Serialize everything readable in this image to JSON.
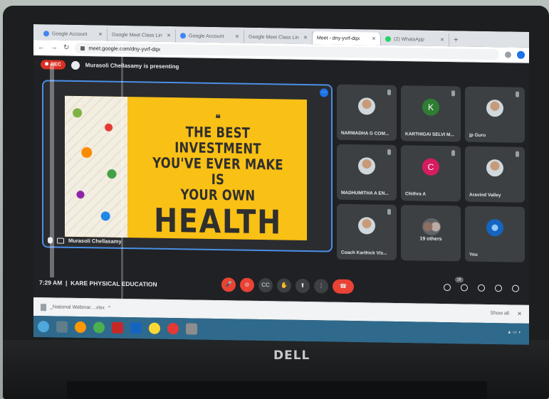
{
  "browser": {
    "tabs": [
      {
        "label": "Google Account",
        "active": false
      },
      {
        "label": "Google Meet Class Lin",
        "active": false
      },
      {
        "label": "Google Account",
        "active": false
      },
      {
        "label": "Google Meet Class Lin",
        "active": false
      },
      {
        "label": "Meet - dny-yvrf-dqx",
        "active": true
      },
      {
        "label": "(2) WhatsApp",
        "active": false
      }
    ],
    "url": "meet.google.com/dny-yvrf-dqx"
  },
  "meet": {
    "rec_label": "REC",
    "presenting_text": "Murasoli Chellasamy is presenting",
    "slide": {
      "line1": "THE BEST INVESTMENT",
      "line2": "YOU'VE EVER MAKE IS",
      "line3": "YOUR OWN",
      "line4": "HEALTH"
    },
    "presenter_name": "Murasoli Chellasamy",
    "participants": [
      {
        "name": "NARMADHA G COM...",
        "avatar": "photo"
      },
      {
        "name": "KARTHIGAI SELVI M...",
        "avatar": "K"
      },
      {
        "name": "jp Guru",
        "avatar": "photo"
      },
      {
        "name": "MADHUMITHA A EN...",
        "avatar": "photo"
      },
      {
        "name": "Chithra A",
        "avatar": "C"
      },
      {
        "name": "Aravind Valley",
        "avatar": "photo"
      },
      {
        "name": "Coach Karthick Vis...",
        "avatar": "photo"
      },
      {
        "name": "",
        "center_label": "19 others",
        "avatar": "group"
      },
      {
        "name": "You",
        "avatar": "photo"
      }
    ],
    "time": "7:29 AM",
    "meeting_title": "KARE PHYSICAL EDUCATION",
    "participant_count": "28"
  },
  "downloads": {
    "file_label": "_National Webinar....xlsx",
    "show_all": "Show all"
  },
  "hardware": {
    "brand": "DELL"
  },
  "colors": {
    "slide_bg": "#f9c015",
    "stage_border": "#4a8fe7",
    "meet_bg": "#202124",
    "end_call": "#ea4335"
  }
}
